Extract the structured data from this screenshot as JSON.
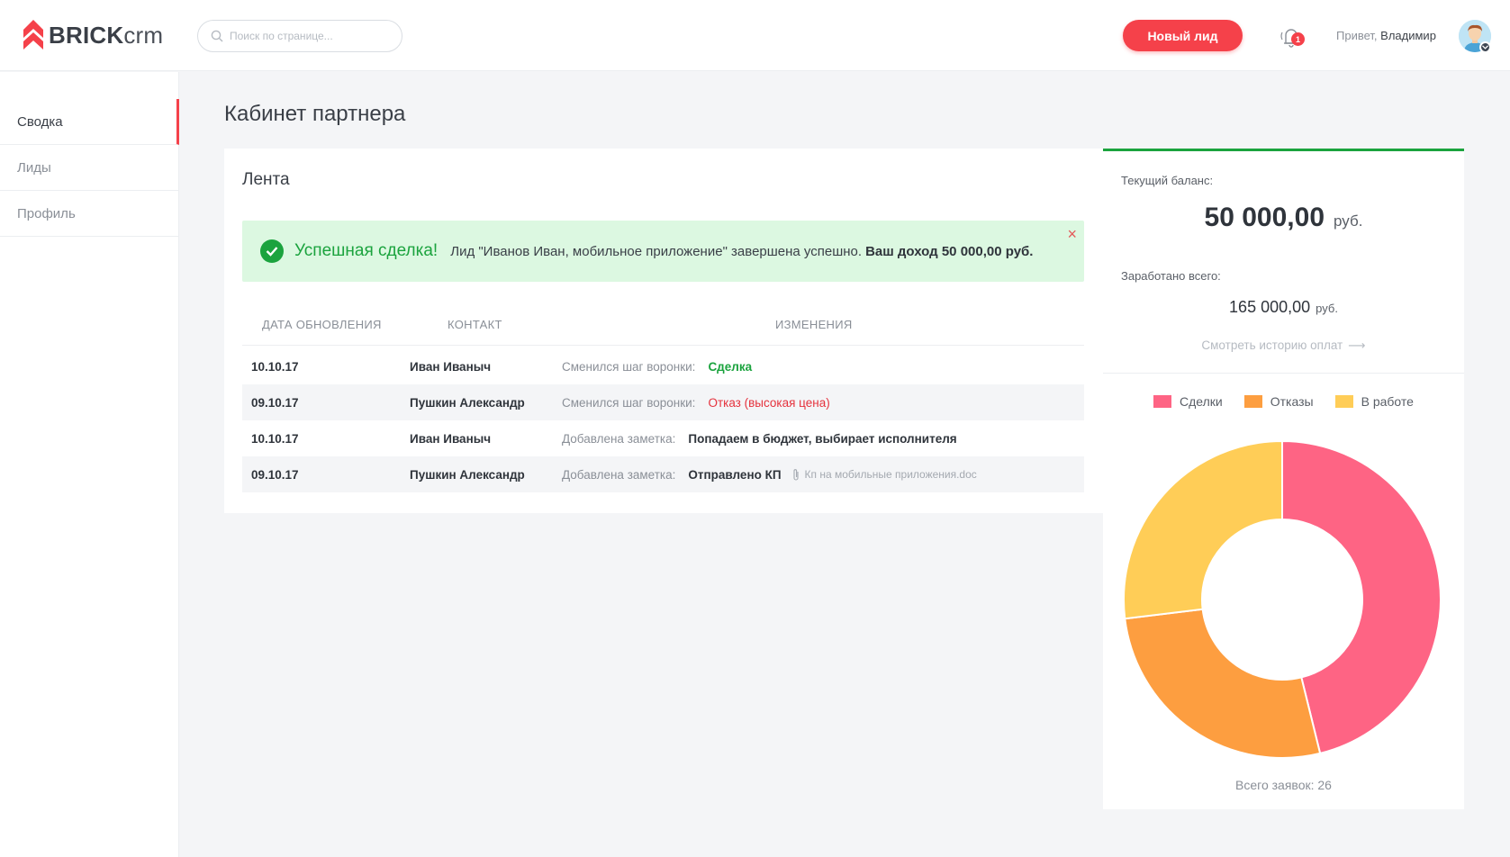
{
  "header": {
    "logo_bold": "BRICK",
    "logo_light": "crm",
    "search_placeholder": "Поиск по странице...",
    "new_lead_button": "Новый лид",
    "notification_count": "1",
    "greeting_prefix": "Привет,",
    "user_name": "Владимир"
  },
  "sidebar": {
    "items": [
      {
        "label": "Сводка"
      },
      {
        "label": "Лиды"
      },
      {
        "label": "Профиль"
      }
    ]
  },
  "main": {
    "page_title": "Кабинет партнера",
    "feed": {
      "title": "Лента",
      "alert": {
        "title": "Успешная сделка!",
        "text": "Лид \"Иванов Иван, мобильное приложение\" завершена успешно.",
        "bold_text": "Ваш доход 50 000,00 руб.",
        "close": "×"
      },
      "columns": [
        "ДАТА ОБНОВЛЕНИЯ",
        "КОНТАКТ",
        "ИЗМЕНЕНИЯ"
      ],
      "rows": [
        {
          "date": "10.10.17",
          "contact": "Иван Иваныч",
          "change": "Сменился шаг воронки:",
          "value": "Сделка"
        },
        {
          "date": "09.10.17",
          "contact": "Пушкин Александр",
          "change": "Сменился шаг воронки:",
          "value": "Отказ (высокая цена)"
        },
        {
          "date": "10.10.17",
          "contact": "Иван Иваныч",
          "change": "Добавлена заметка:",
          "value": "Попадаем в бюджет, выбирает исполнителя"
        },
        {
          "date": "09.10.17",
          "contact": "Пушкин Александр",
          "change": "Добавлена заметка:",
          "value": "Отправлено КП",
          "attachment": "Кп на мобильные приложения.doc"
        }
      ]
    }
  },
  "panel": {
    "balance_label": "Текущий баланс:",
    "balance_value": "50 000,00",
    "balance_currency": "руб.",
    "earned_label": "Заработано всего:",
    "earned_value": "165 000,00",
    "earned_currency": "руб.",
    "history_link": "Смотреть историю оплат",
    "history_arrow": "⟶",
    "total_label": "Всего заявок: 26"
  },
  "chart_data": {
    "type": "pie",
    "donut": true,
    "total": 26,
    "series": [
      {
        "name": "Сделки",
        "value": 12,
        "color": "#fe6484"
      },
      {
        "name": "Отказы",
        "value": 7,
        "color": "#fd9e40"
      },
      {
        "name": "В работе",
        "value": 7,
        "color": "#ffcd57"
      }
    ]
  },
  "colors": {
    "accent": "#f5414a",
    "success": "#1ba33e",
    "danger": "#e5323d"
  }
}
